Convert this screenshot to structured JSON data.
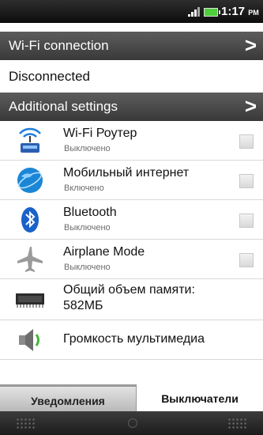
{
  "status_bar": {
    "time": "1:17",
    "ampm": "PM"
  },
  "wifi_header": {
    "label": "Wi-Fi connection"
  },
  "wifi_status": "Disconnected",
  "additional_header": {
    "label": "Additional settings"
  },
  "rows": [
    {
      "title": "Wi-Fi Роутер",
      "subtitle": "Выключено",
      "icon": "wifi-router-icon"
    },
    {
      "title": "Мобильный интернет",
      "subtitle": "Включено",
      "icon": "mobile-internet-globe-icon"
    },
    {
      "title": "Bluetooth",
      "subtitle": "Выключено",
      "icon": "bluetooth-icon"
    },
    {
      "title": "Airplane Mode",
      "subtitle": "Выключено",
      "icon": "airplane-icon"
    },
    {
      "title": "Общий объем памяти: 582МБ",
      "line1": "Общий объем памяти:",
      "line2": "582МБ",
      "icon": "memory-chip-icon"
    },
    {
      "title": "Громкость мультимедиа",
      "icon": "speaker-icon"
    }
  ],
  "tabs": {
    "notifications": "Уведомления",
    "switches": "Выключатели"
  },
  "colors": {
    "header_bg": "#4a4a4a",
    "accent_green": "#4fcf3c",
    "tab_active": "#ffffff"
  }
}
